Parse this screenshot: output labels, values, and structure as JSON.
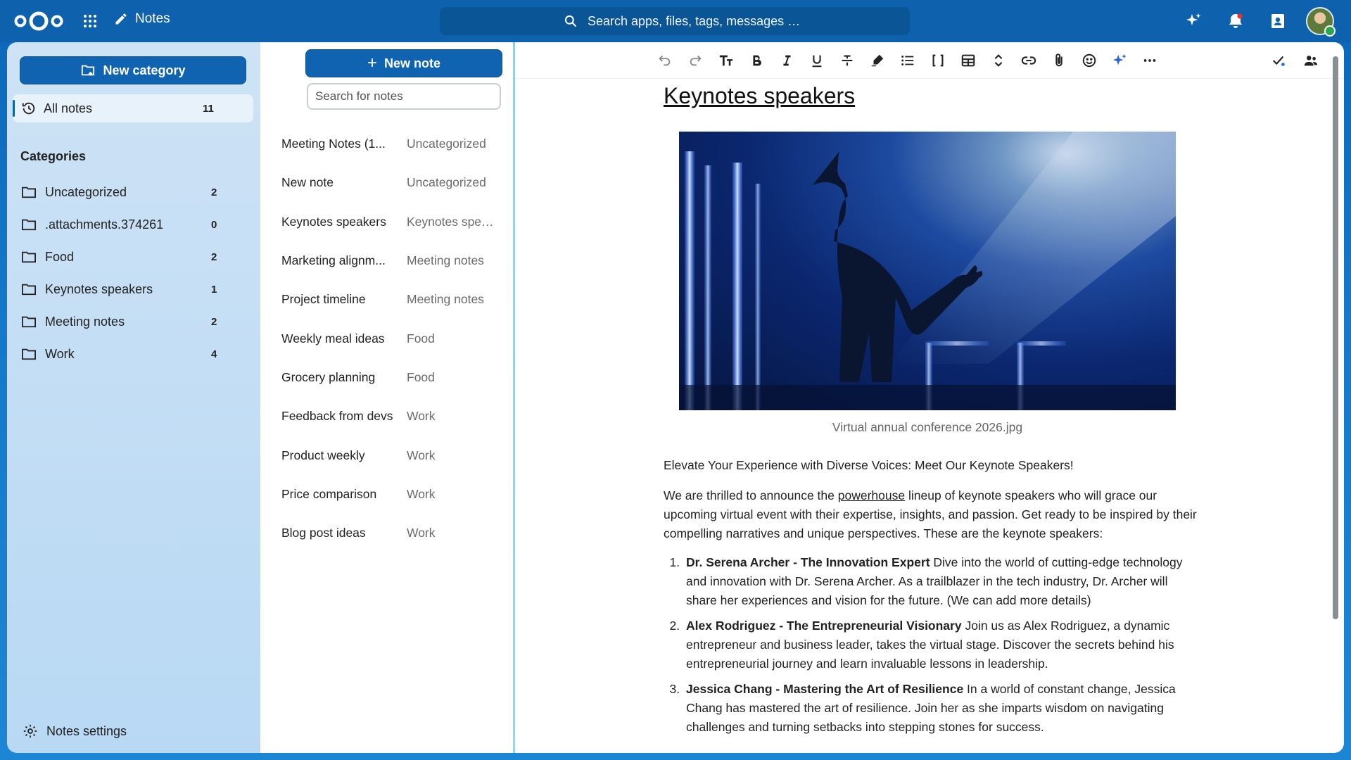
{
  "header": {
    "app_name": "Notes",
    "search_placeholder": "Search apps, files, tags, messages …",
    "icons": [
      "apps-grid-icon",
      "pencil-icon",
      "search-icon",
      "assistant-sparkle-icon",
      "notifications-bell-icon",
      "contacts-icon",
      "user-avatar"
    ]
  },
  "nav": {
    "new_category_label": "New category",
    "all_notes": {
      "label": "All notes",
      "count": "11"
    },
    "categories_heading": "Categories",
    "categories": [
      {
        "label": "Uncategorized",
        "count": "2"
      },
      {
        "label": ".attachments.374261",
        "count": "0"
      },
      {
        "label": "Food",
        "count": "2"
      },
      {
        "label": "Keynotes speakers",
        "count": "1"
      },
      {
        "label": "Meeting notes",
        "count": "2"
      },
      {
        "label": "Work",
        "count": "4"
      }
    ],
    "settings_label": "Notes settings"
  },
  "list": {
    "new_note_label": "New note",
    "search_placeholder": "Search for notes",
    "notes": [
      {
        "title": "Meeting Notes (1...",
        "category": "Uncategorized"
      },
      {
        "title": "New note",
        "category": "Uncategorized"
      },
      {
        "title": "Keynotes speakers",
        "category": "Keynotes spea..."
      },
      {
        "title": "Marketing alignm...",
        "category": "Meeting notes"
      },
      {
        "title": "Project timeline",
        "category": "Meeting notes"
      },
      {
        "title": "Weekly meal ideas",
        "category": "Food"
      },
      {
        "title": "Grocery planning",
        "category": "Food"
      },
      {
        "title": "Feedback from devs",
        "category": "Work"
      },
      {
        "title": "Product weekly",
        "category": "Work"
      },
      {
        "title": "Price comparison",
        "category": "Work"
      },
      {
        "title": "Blog post ideas",
        "category": "Work"
      }
    ]
  },
  "editor": {
    "toolbar_icons": [
      "undo-icon",
      "redo-icon",
      "text-size-icon",
      "bold-icon",
      "italic-icon",
      "underline-icon",
      "strikethrough-icon",
      "highlight-icon",
      "bullet-list-icon",
      "code-block-icon",
      "table-icon",
      "expand-icon",
      "link-icon",
      "attachment-icon",
      "emoji-icon",
      "assistant-icon",
      "more-icon",
      "saved-check-icon",
      "collaborators-icon"
    ],
    "title": "Keynotes speakers",
    "image_caption": "Virtual annual conference 2026.jpg",
    "intro": "Elevate Your Experience with Diverse Voices: Meet Our Keynote Speakers!",
    "para_before_link": "We are thrilled to announce the ",
    "para_link": "powerhouse",
    "para_after_link": " lineup of keynote speakers who will grace our upcoming virtual event with their expertise, insights, and passion. Get ready to be inspired by their compelling narratives and unique perspectives. These are the keynote speakers:",
    "speakers": [
      {
        "heading": "Dr. Serena Archer - The Innovation Expert",
        "text": " Dive into the world of cutting-edge technology and innovation with Dr. Serena Archer. As a trailblazer in the tech industry, Dr. Archer will share her experiences and vision for the future. (We can add more details)"
      },
      {
        "heading": "Alex Rodriguez - The Entrepreneurial Visionary",
        "text": " Join us as Alex Rodriguez, a dynamic entrepreneur and business leader, takes the virtual stage. Discover the secrets behind his entrepreneurial journey and learn invaluable lessons in leadership."
      },
      {
        "heading": "Jessica Chang - Mastering the Art of Resilience",
        "text": " In a world of constant change, Jessica Chang has mastered the art of resilience. Join her as she imparts wisdom on navigating challenges and turning setbacks into stepping stones for success."
      }
    ]
  },
  "colors": {
    "header": "#0e62ad",
    "primary_button": "#0f63b0",
    "nav_background": "#d6e9f9"
  }
}
